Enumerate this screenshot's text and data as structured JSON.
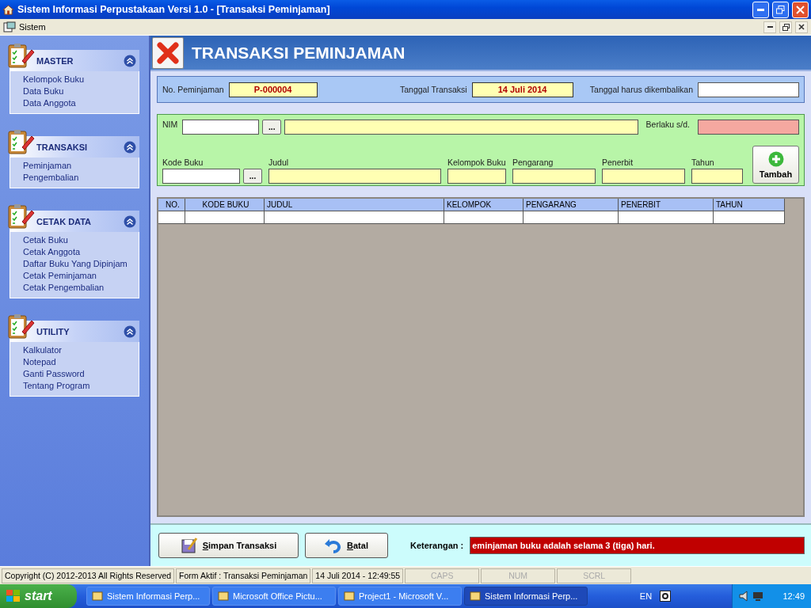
{
  "window": {
    "title": "Sistem Informasi Perpustakaan Versi 1.0 - [Transaksi Peminjaman]"
  },
  "menu": [
    "Sistem"
  ],
  "sidebar": {
    "groups": [
      {
        "title": "MASTER",
        "expanded": true,
        "items": [
          "Kelompok Buku",
          "Data Buku",
          "Data Anggota"
        ]
      },
      {
        "title": "TRANSAKSI",
        "expanded": true,
        "items": [
          "Peminjaman",
          "Pengembalian"
        ]
      },
      {
        "title": "CETAK DATA",
        "expanded": true,
        "items": [
          "Cetak Buku",
          "Cetak Anggota",
          "Daftar Buku Yang Dipinjam",
          "Cetak Peminjaman",
          "Cetak Pengembalian"
        ]
      },
      {
        "title": "UTILITY",
        "expanded": true,
        "items": [
          "Kalkulator",
          "Notepad",
          "Ganti Password",
          "Tentang Program"
        ]
      }
    ]
  },
  "form": {
    "title": "TRANSAKSI PEMINJAMAN",
    "header_fields": [
      {
        "label": "No. Peminjaman",
        "value": "P-000004",
        "kind": "readonly"
      },
      {
        "label": "Tanggal Transaksi",
        "value": "14 Juli 2014",
        "kind": "readonly"
      },
      {
        "label": "Tanggal harus dikembalikan",
        "kind": "input"
      }
    ],
    "member": {
      "nim_label": "NIM",
      "browse": "...",
      "berlaku_label": "Berlaku s/d."
    },
    "book_fields": [
      {
        "label": "Kode Buku",
        "kind": "browse",
        "browse": "..."
      },
      {
        "label": "Judul",
        "kind": "text"
      },
      {
        "label": "Kelompok Buku",
        "kind": "text"
      },
      {
        "label": "Pengarang",
        "kind": "text"
      },
      {
        "label": "Penerbit",
        "kind": "text"
      },
      {
        "label": "Tahun",
        "kind": "text"
      }
    ],
    "add_button": "Tambah",
    "table": {
      "columns": [
        "NO.",
        "KODE BUKU",
        "JUDUL",
        "KELOMPOK",
        "PENGARANG",
        "PENERBIT",
        "TAHUN"
      ]
    },
    "save_button": {
      "mnemonic": "S",
      "rest": "impan Transaksi"
    },
    "cancel_button": {
      "mnemonic": "B",
      "rest": "atal"
    },
    "note_label": "Keterangan :",
    "note": "eminjaman buku adalah selama 3 (tiga) hari."
  },
  "status_bar": [
    {
      "text": "Copyright (C) 2012-2013 All Rights Reserved",
      "on": true
    },
    {
      "text": "Form Aktif : Transaksi Peminjaman",
      "on": true
    },
    {
      "text": "14 Juli 2014 - 12:49:55",
      "on": true
    },
    {
      "text": "CAPS",
      "on": false
    },
    {
      "text": "NUM",
      "on": false
    },
    {
      "text": "SCRL",
      "on": false
    }
  ],
  "taskbar": {
    "start": "start",
    "tasks": [
      {
        "label": "Sistem Informasi Perp...",
        "selected": false
      },
      {
        "label": "Microsoft Office Pictu...",
        "selected": false
      },
      {
        "label": "Project1 - Microsoft V...",
        "selected": false
      },
      {
        "label": "Sistem Informasi Perp...",
        "selected": true
      }
    ],
    "language": "EN",
    "clock": "12:49"
  }
}
